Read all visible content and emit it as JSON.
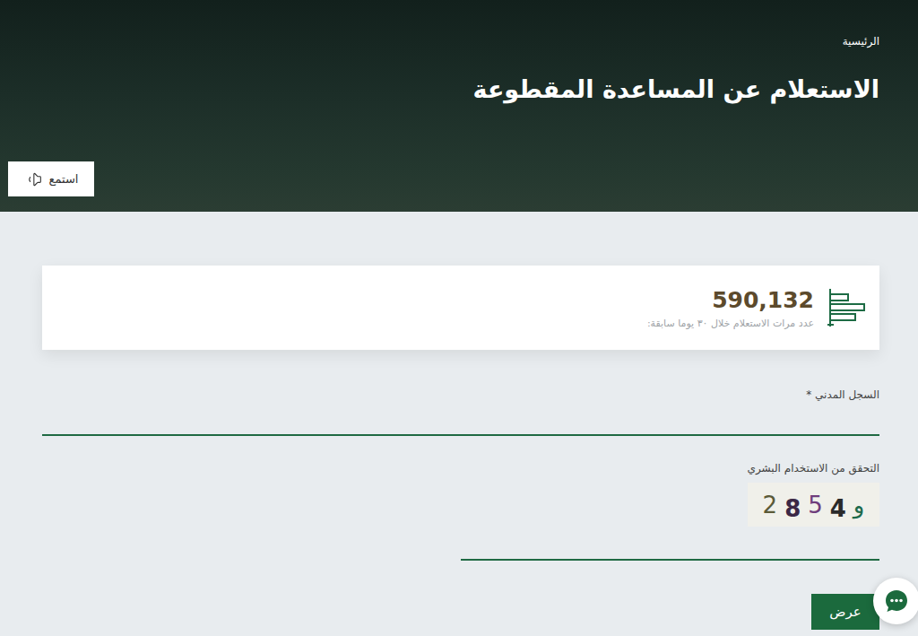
{
  "breadcrumb": "الرئيسية",
  "page_title": "الاستعلام عن المساعدة المقطوعة",
  "listen_button": "استمع",
  "stats": {
    "count": "590,132",
    "caption": "عدد مرات الاستعلام خلال ٣٠ يوما سابقة:"
  },
  "form": {
    "civil_id": {
      "label": "السجل المدني *"
    },
    "captcha": {
      "label": "التحقق من الاستخدام البشري",
      "chars": [
        {
          "char": "2",
          "color": "#5b5a38"
        },
        {
          "char": "8",
          "color": "#3b2846"
        },
        {
          "char": "5",
          "color": "#6e3d7c"
        },
        {
          "char": "4",
          "color": "#2a2a2a"
        },
        {
          "char": "و",
          "color": "#1c6a4c"
        }
      ]
    },
    "submit": "عرض"
  }
}
